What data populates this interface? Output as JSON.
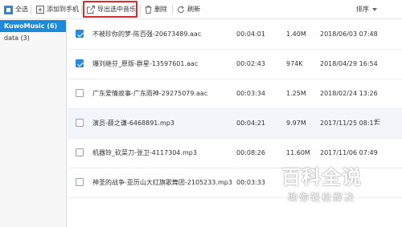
{
  "toolbar": {
    "select_all": "全选",
    "add_to_phone": "添加到手机",
    "export_selected": "导出选中音乐",
    "delete": "删除",
    "refresh": "刷新",
    "sort": "排序"
  },
  "sidebar": {
    "items": [
      {
        "label": "KuwoMusic (6)",
        "active": true
      },
      {
        "label": "data (3)",
        "active": false
      }
    ]
  },
  "songs": [
    {
      "name": "不被珍你的梦-陈百强-20673489.aac",
      "duration": "00:04:01",
      "size": "1.40M",
      "date": "2018/06/03 07:48",
      "checked": true
    },
    {
      "name": "爆刘继芬_原版-群星-13597601.aac",
      "duration": "00:02:43",
      "size": "974K",
      "date": "2018/04/29 16:54",
      "checked": true
    },
    {
      "name": "广东爱情故事-广东雨神-29275079.aac",
      "duration": "00:03:34",
      "size": "1.25M",
      "date": "2018/02/24 13:26",
      "checked": false
    },
    {
      "name": "演员-薛之谦-6468891.mp3",
      "duration": "00:04:21",
      "size": "9.97M",
      "date": "2017/11/25 08:17",
      "checked": false
    },
    {
      "name": "机器铃_砍菜刀-张卫-4117304.mp3",
      "duration": "00:08:26",
      "size": "11.60M",
      "date": "2017/11/06 07:49",
      "checked": false
    },
    {
      "name": "神圣的战争-亚历山大红旗歌舞团-2105233.mp3",
      "duration": "00:03:33",
      "size": "",
      "date": "",
      "checked": false
    }
  ],
  "watermark": {
    "line1": "百科全说",
    "line2": "助你轻松解决"
  },
  "colors": {
    "accent": "#1b8ad8",
    "highlight_box": "#d92b2b",
    "alt_row": "#f2f6fa"
  }
}
